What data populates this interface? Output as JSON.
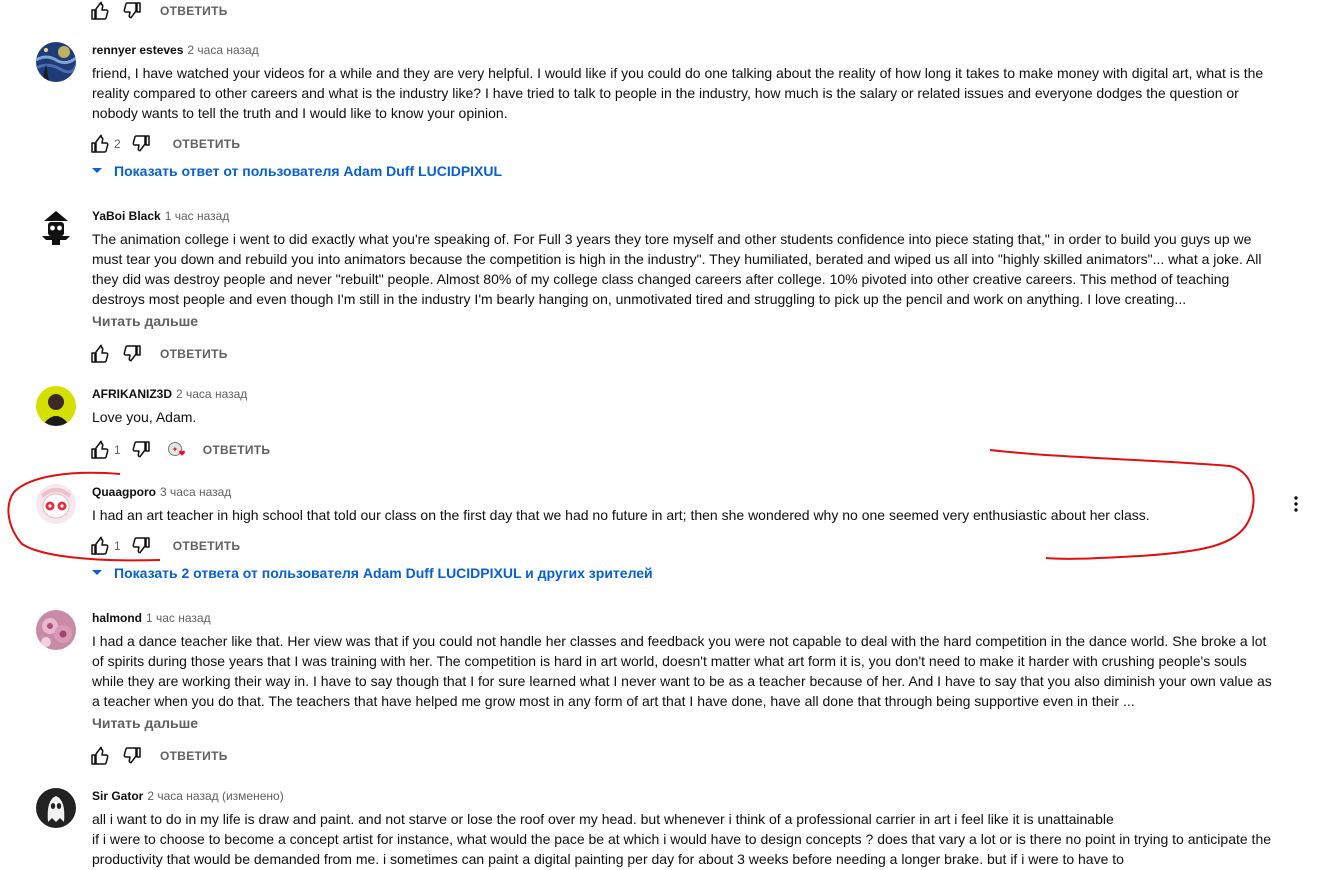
{
  "labels": {
    "reply": "ОТВЕТИТЬ",
    "read_more": "Читать дальше"
  },
  "comments": [
    {
      "author": "rennyer esteves",
      "time": "2 часа назад",
      "text": "friend, I have watched your videos for a while and they are very helpful. I would like if you could do one talking about the reality of how long it takes to make money with digital art, what is the reality compared to other careers and what is the industry like? I have tried to talk to people in the industry, how much is the salary or related issues and everyone dodges the question or nobody wants to tell the truth and I would like to know your opinion.",
      "likes": "2",
      "replies_link": "Показать ответ от пользователя Adam Duff LUCIDPIXUL"
    },
    {
      "author": "YaBoi Black",
      "time": "1 час назад",
      "text": "The animation college i went to did exactly what you're speaking of. For Full 3 years they tore myself and other students  confidence into piece stating that,\" in order to build you guys up we must tear you down and rebuild you into animators because the competition is high in the industry\". They humiliated, berated and wiped us all into \"highly skilled animators\"... what a joke. All they did was destroy people and never \"rebuilt\" people. Almost 80% of my college class changed careers after college. 10% pivoted into other creative careers. This method of teaching destroys most people and even though I'm still in the industry I'm bearly hanging on, unmotivated tired and struggling to pick up the pencil and work on anything. I love creating...",
      "likes": ""
    },
    {
      "author": "AFRIKANIZ3D",
      "time": "2 часа назад",
      "text": "Love you, Adam.",
      "likes": "1"
    },
    {
      "author": "Quaagporo",
      "time": "3 часа назад",
      "text": "I had an art teacher in high school that told our class on the first day that we had no future in art; then she wondered why no one seemed very enthusiastic about her class.",
      "likes": "1",
      "replies_link": "Показать 2 ответа от пользователя Adam Duff LUCIDPIXUL и других зрителей"
    },
    {
      "author": "halmond",
      "time": "1 час назад",
      "text": "I had a dance teacher like that. Her view was that if you could not handle her classes and feedback you were not capable to deal with the hard competition in the dance world. She broke a lot of spirits during those years that I was training with her. The competition is hard in art world, doesn't matter what art form it is, you don't need to make it harder with crushing people's souls while they are working their way in. I have to say though that I for sure learned what I never want to be as a teacher because of her. And I have to say that you also diminish your own value as a teacher when you do that. The teachers that have helped me grow most in any form of art that I have done, have all done that through being supportive even in their ...",
      "likes": ""
    },
    {
      "author": "Sir Gator",
      "time": "2 часа назад (изменено)",
      "line1": "all i want to do in my life is draw and paint. and not starve or lose the roof over my head. but whenever i think of a professional carrier in art i feel like it is unattainable",
      "line2": "if i were to choose to become a concept artist for instance, what would the pace be at which i would have to design concepts ? does that vary a lot or is there no point in trying to anticipate the productivity that would be demanded from me. i sometimes can paint a digital painting per day for about 3 weeks before needing a longer brake. but if i were to have to"
    }
  ],
  "colors": {
    "link": "#065fd4",
    "secondary_text": "#606060",
    "annotation": "#e01010",
    "heart": "#ff0033"
  },
  "icons": [
    "thumb-up-icon",
    "thumb-down-icon",
    "creator-heart-icon",
    "expand-triangle-icon",
    "more-vert-icon"
  ]
}
